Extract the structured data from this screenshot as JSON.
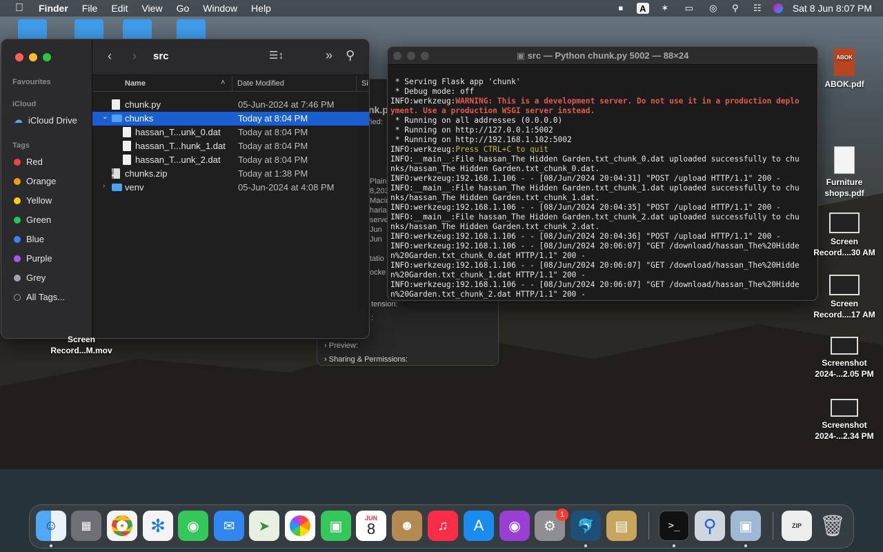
{
  "menubar": {
    "app_name": "Finder",
    "items": [
      "File",
      "Edit",
      "View",
      "Go",
      "Window",
      "Help"
    ],
    "datetime": "Sat 8 Jun  8:07 PM",
    "input_source": "A"
  },
  "finder": {
    "title": "src",
    "sidebar": {
      "favourites_heading": "Favourites",
      "icloud_heading": "iCloud",
      "icloud_drive": "iCloud Drive",
      "tags_heading": "Tags",
      "tags": [
        {
          "label": "Red",
          "color": "#ef4444"
        },
        {
          "label": "Orange",
          "color": "#f59e0b"
        },
        {
          "label": "Yellow",
          "color": "#facc15"
        },
        {
          "label": "Green",
          "color": "#22c55e"
        },
        {
          "label": "Blue",
          "color": "#3b82f6"
        },
        {
          "label": "Purple",
          "color": "#a855f7"
        },
        {
          "label": "Grey",
          "color": "#9ca3af"
        }
      ],
      "all_tags": "All Tags..."
    },
    "columns": {
      "name": "Name",
      "date_modified": "Date Modified",
      "size_partial": "Si"
    },
    "rows": [
      {
        "name": "chunk.py",
        "date": "05-Jun-2024 at 7:46 PM"
      },
      {
        "name": "chunks",
        "date": "Today at 8:04 PM"
      },
      {
        "name": "hassan_T...unk_0.dat",
        "date": "Today at 8:04 PM"
      },
      {
        "name": "hassan_T...hunk_1.dat",
        "date": "Today at 8:04 PM"
      },
      {
        "name": "hassan_T...unk_2.dat",
        "date": "Today at 8:04 PM"
      },
      {
        "name": "chunks.zip",
        "date": "Today at 1:38 PM"
      },
      {
        "name": "venv",
        "date": "05-Jun-2024 at 4:08 PM"
      }
    ]
  },
  "info_window": {
    "partial_lines": [
      "nk.p",
      "fied:",
      "Plain",
      "8,203",
      "Macin",
      "haria",
      "serve",
      "Jun",
      "Jun",
      "tatio",
      "ocke"
    ],
    "extension": "tension:",
    "colon": ":",
    "preview": "Preview:",
    "sharing": "Sharing & Permissions:"
  },
  "terminal": {
    "title": "src — Python chunk.py 5002 — 88×24",
    "lines": [
      " * Serving Flask app 'chunk'",
      " * Debug mode: off",
      "INFO:werkzeug:",
      "WARNING: This is a development server. Do not use it in a production deplo",
      "yment. Use a production WSGI server instead.",
      " * Running on all addresses (0.0.0.0)",
      " * Running on http://127.0.0.1:5002",
      " * Running on http://192.168.1.102:5002",
      "INFO:werkzeug:",
      "Press CTRL+C to quit",
      "INFO:__main__:File hassan_The Hidden Garden.txt_chunk_0.dat uploaded successfully to chu",
      "nks/hassan_The Hidden Garden.txt_chunk_0.dat.",
      "INFO:werkzeug:192.168.1.106 - - [08/Jun/2024 20:04:31] \"POST /upload HTTP/1.1\" 200 -",
      "INFO:__main__:File hassan_The Hidden Garden.txt_chunk_1.dat uploaded successfully to chu",
      "nks/hassan_The Hidden Garden.txt_chunk_1.dat.",
      "INFO:werkzeug:192.168.1.106 - - [08/Jun/2024 20:04:35] \"POST /upload HTTP/1.1\" 200 -",
      "INFO:__main__:File hassan_The Hidden Garden.txt_chunk_2.dat uploaded successfully to chu",
      "nks/hassan_The Hidden Garden.txt_chunk_2.dat.",
      "INFO:werkzeug:192.168.1.106 - - [08/Jun/2024 20:04:36] \"POST /upload HTTP/1.1\" 200 -",
      "INFO:werkzeug:192.168.1.106 - - [08/Jun/2024 20:06:07] \"GET /download/hassan_The%20Hidde",
      "n%20Garden.txt_chunk_0.dat HTTP/1.1\" 200 -",
      "INFO:werkzeug:192.168.1.106 - - [08/Jun/2024 20:06:07] \"GET /download/hassan_The%20Hidde",
      "n%20Garden.txt_chunk_1.dat HTTP/1.1\" 200 -",
      "INFO:werkzeug:192.168.1.106 - - [08/Jun/2024 20:06:07] \"GET /download/hassan_The%20Hidde",
      "n%20Garden.txt_chunk_2.dat HTTP/1.1\" 200 -"
    ]
  },
  "desktop": {
    "icons": [
      {
        "label": "ABOK.pdf"
      },
      {
        "label": "Furniture shops.pdf"
      },
      {
        "label": "Screen Record....30 AM"
      },
      {
        "label": "Screen Record....17 AM"
      },
      {
        "label": "Screenshot 2024-...2.05 PM"
      },
      {
        "label": "Screenshot 2024-...2.34 PM"
      },
      {
        "label": "Screen Record...M.mov"
      }
    ],
    "abok_badge": "ABOK"
  },
  "dock": {
    "calendar_month": "JUN",
    "calendar_day": "8",
    "settings_badge": "1",
    "zip_label": "ZIP"
  }
}
